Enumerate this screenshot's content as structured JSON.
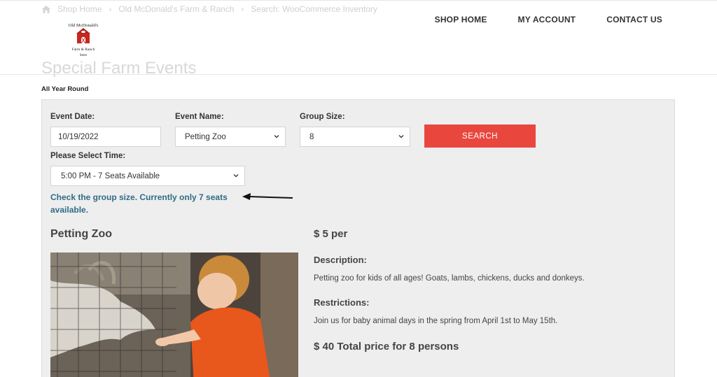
{
  "breadcrumb": [
    "Shop Home",
    "Old McDonald's Farm & Ranch",
    "Search: WooCommerce Inventory"
  ],
  "page_title_bg": "Special Farm Events",
  "logo": {
    "line1": "Old McDonald's",
    "line2": "Farm & Ranch",
    "line3": "Store"
  },
  "nav": [
    {
      "label": "SHOP HOME"
    },
    {
      "label": "MY ACCOUNT"
    },
    {
      "label": "CONTACT US"
    }
  ],
  "season": "All Year Round",
  "form": {
    "event_date_label": "Event Date:",
    "event_date_value": "10/19/2022",
    "event_name_label": "Event Name:",
    "event_name_value": "Petting Zoo",
    "group_size_label": "Group Size:",
    "group_size_value": "8",
    "search_label": "SEARCH",
    "time_label": "Please Select Time:",
    "time_value": "5:00 PM - 7 Seats Available"
  },
  "warning": "Check the group size. Currently only 7 seats available.",
  "event": {
    "title": "Petting Zoo",
    "price": "$ 5 per",
    "description_heading": "Description:",
    "description": "Petting zoo for kids of all ages! Goats, lambs, chickens, ducks and donkeys.",
    "restrictions_heading": "Restrictions:",
    "restrictions": "Join us for baby animal days in the spring from April 1st to May 15th.",
    "total": "$ 40 Total price for 8 persons"
  },
  "colors": {
    "accent": "#e9473e",
    "warning_text": "#2f6c86",
    "panel": "#eeeeee"
  }
}
